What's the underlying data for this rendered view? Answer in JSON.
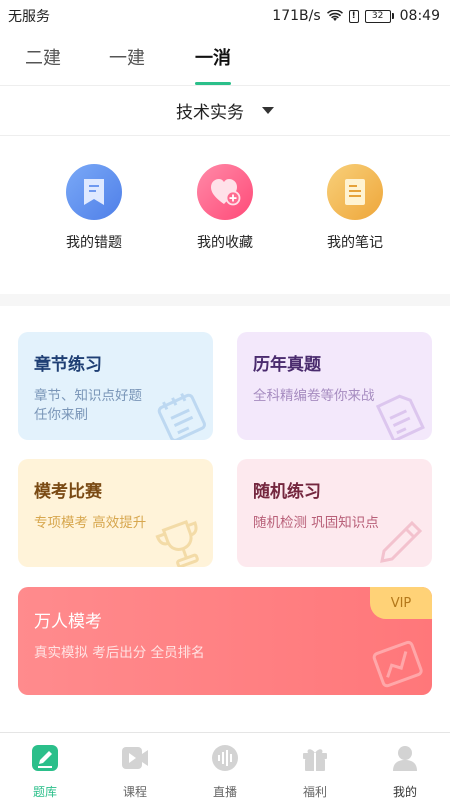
{
  "status_bar": {
    "carrier": "无服务",
    "network_speed": "171B/s",
    "sim_mark": "!",
    "battery_level": "32",
    "time": "08:49"
  },
  "top_tabs": [
    {
      "label": "二建",
      "active": false
    },
    {
      "label": "一建",
      "active": false
    },
    {
      "label": "一消",
      "active": true
    }
  ],
  "subject": {
    "label": "技术实务"
  },
  "quick_actions": [
    {
      "label": "我的错题",
      "icon": "bookmark-book-icon",
      "color": "#5b8ff0"
    },
    {
      "label": "我的收藏",
      "icon": "heart-plus-icon",
      "color": "#ff5c86"
    },
    {
      "label": "我的笔记",
      "icon": "note-icon",
      "color": "#f2b64a"
    }
  ],
  "cards": {
    "chapter": {
      "title": "章节练习",
      "desc_line1": "章节、知识点好题",
      "desc_line2": "任你来刷"
    },
    "past": {
      "title": "历年真题",
      "desc": "全科精编卷等你来战"
    },
    "mock": {
      "title": "模考比赛",
      "desc": "专项模考 高效提升"
    },
    "random": {
      "title": "随机练习",
      "desc": "随机检测 巩固知识点"
    },
    "massive": {
      "title": "万人模考",
      "desc": "真实模拟 考后出分 全员排名",
      "badge": "VIP"
    }
  },
  "bottom_nav": [
    {
      "label": "题库",
      "icon": "pencil-question-icon",
      "active": true
    },
    {
      "label": "课程",
      "icon": "video-play-icon",
      "active": false
    },
    {
      "label": "直播",
      "icon": "live-wave-icon",
      "active": false
    },
    {
      "label": "福利",
      "icon": "gift-icon",
      "active": false
    },
    {
      "label": "我的",
      "icon": "user-icon",
      "active": false
    }
  ],
  "colors": {
    "accent": "#2bbf8a",
    "vip": "#ffd277"
  }
}
